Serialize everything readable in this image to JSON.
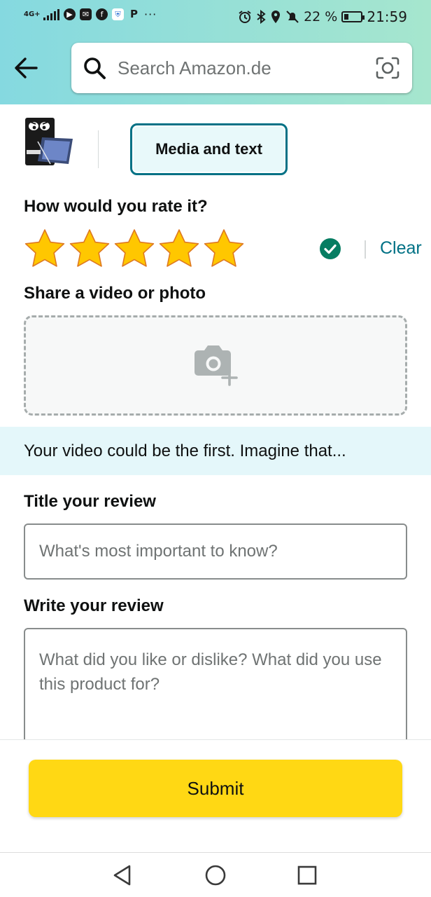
{
  "status_bar": {
    "network": "4G+",
    "battery_percent": "22 %",
    "time": "21:59",
    "overflow": "···",
    "icons": [
      "signal-icon",
      "shield-app-icon",
      "mail-app-icon",
      "facebook-icon",
      "vpn-shield-icon",
      "paypal-icon",
      "alarm-icon",
      "bluetooth-icon",
      "location-icon",
      "mute-bell-icon",
      "battery-icon"
    ]
  },
  "header": {
    "search_placeholder": "Search Amazon.de",
    "back_icon": "back-arrow-icon",
    "search_icon": "search-icon",
    "camera_icon": "camera-lens-icon"
  },
  "product": {
    "media_tab_label": "Media and text"
  },
  "rating": {
    "heading": "How would you rate it?",
    "value": 5,
    "max": 5,
    "star_color": "#ffc700",
    "clear_label": "Clear",
    "check_color": "#067d62"
  },
  "media": {
    "heading": "Share a video or photo",
    "upload_icon": "add-photo-camera-icon",
    "banner_text": "Your video could be the first. Imagine that..."
  },
  "review_title": {
    "heading": "Title your review",
    "placeholder": "What's most important to know?"
  },
  "review_body": {
    "heading": "Write your review",
    "placeholder": "What did you like or dislike? What did you use this product for?"
  },
  "footer": {
    "submit_label": "Submit",
    "submit_color": "#ffd814"
  },
  "colors": {
    "accent_teal": "#007185",
    "header_gradient_start": "#85d9e0",
    "header_gradient_end": "#a6e6ce",
    "banner_bg": "#e4f7fa"
  }
}
